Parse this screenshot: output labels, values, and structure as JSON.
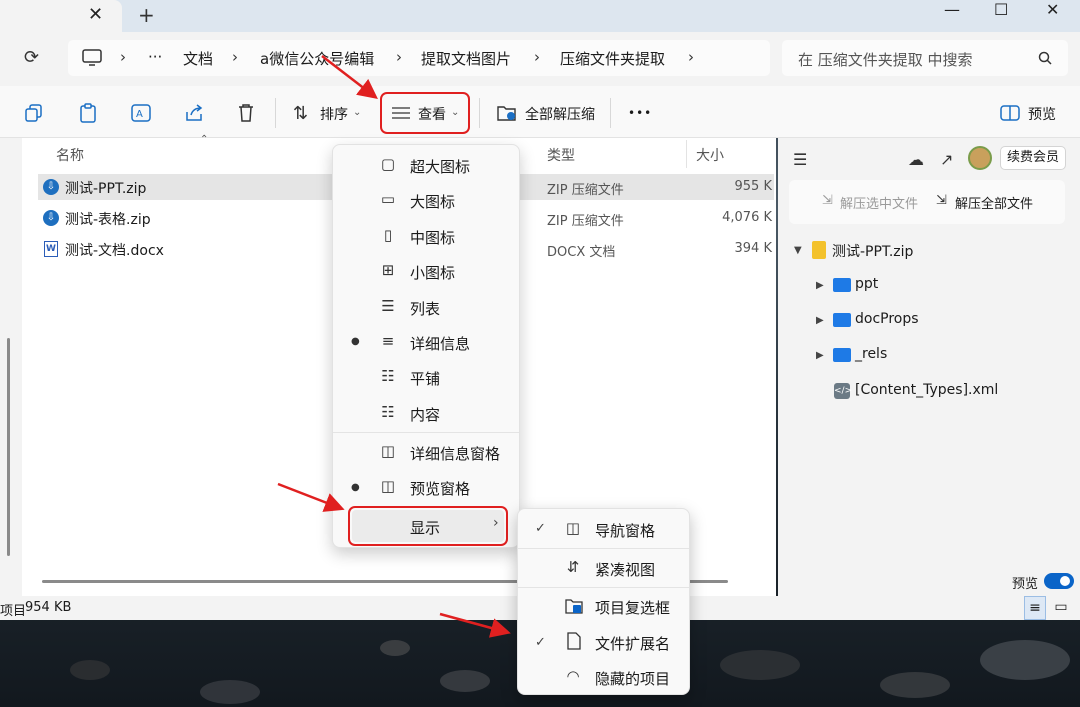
{
  "window": {
    "tab_close": "✕",
    "tab_new": "+",
    "minimize": "—",
    "maximize": "☐",
    "close": "✕"
  },
  "address": {
    "crumbs": [
      "文档",
      "a微信公众号编辑",
      "提取文档图片",
      "压缩文件夹提取"
    ],
    "more": "···",
    "search_placeholder": "在 压缩文件夹提取 中搜索"
  },
  "toolbar": {
    "sort": "排序",
    "view": "查看",
    "extract_all": "全部解压缩",
    "more": "•••",
    "preview": "预览"
  },
  "columns": {
    "name": "名称",
    "type": "类型",
    "size": "大小"
  },
  "files": [
    {
      "name": "测试-PPT.zip",
      "type": "ZIP 压缩文件",
      "size": "955 K"
    },
    {
      "name": "测试-表格.zip",
      "type": "ZIP 压缩文件",
      "size": "4,076 K"
    },
    {
      "name": "测试-文档.docx",
      "type": "DOCX 文档",
      "size": "394 K"
    }
  ],
  "status": {
    "items": "项目",
    "size": "954 KB"
  },
  "view_menu": {
    "items": [
      "超大图标",
      "大图标",
      "中图标",
      "小图标",
      "列表",
      "详细信息",
      "平铺",
      "内容"
    ],
    "panes": [
      "详细信息窗格",
      "预览窗格"
    ],
    "show": "显示"
  },
  "show_submenu": [
    "导航窗格",
    "紧凑视图",
    "项目复选框",
    "文件扩展名",
    "隐藏的项目"
  ],
  "right_panel": {
    "vip": "续费会员",
    "extract_selected": "解压选中文件",
    "extract_all": "解压全部文件",
    "tree_root": "测试-PPT.zip",
    "tree_children": [
      "ppt",
      "docProps",
      "_rels",
      "[Content_Types].xml"
    ],
    "preview_toggle_label": "预览"
  },
  "colors": {
    "accent": "#0a64c8",
    "highlight_red": "#e02020",
    "selected_row": "#e5e5e5"
  }
}
